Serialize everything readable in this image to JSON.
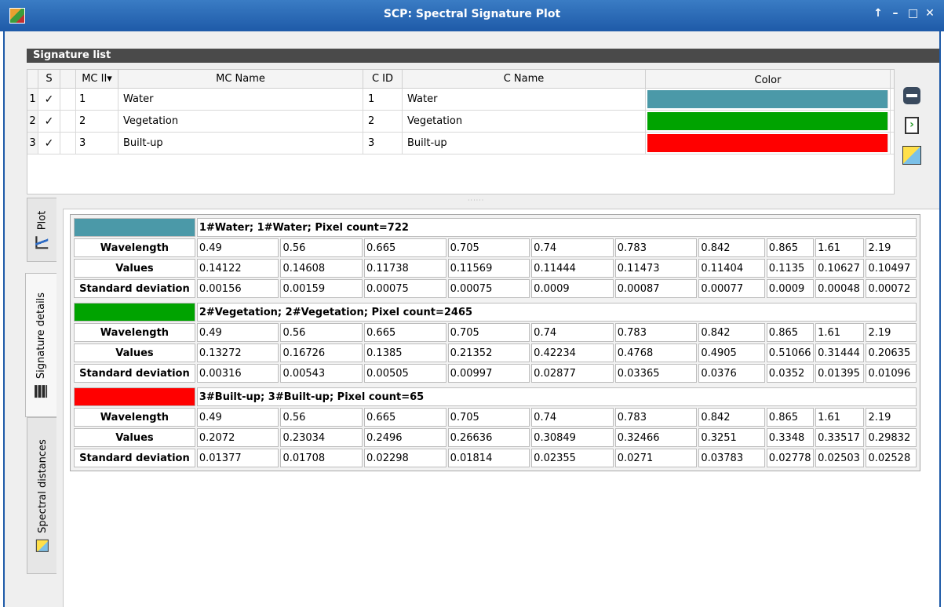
{
  "window": {
    "title": "SCP: Spectral Signature Plot",
    "controls": [
      "↑",
      "–",
      "□",
      "✕"
    ]
  },
  "section": {
    "title": "Signature list"
  },
  "siglist": {
    "headers": {
      "num": "",
      "s": "S",
      "mcid": "MC II",
      "mcid_arrow": "▾",
      "mcname": "MC Name",
      "cid": "C ID",
      "cname": "C Name",
      "color": "Color"
    },
    "rows": [
      {
        "num": "1",
        "check": "✓",
        "mcid": "1",
        "mcname": "Water",
        "cid": "1",
        "cname": "Water",
        "color": "#4b99a8"
      },
      {
        "num": "2",
        "check": "✓",
        "mcid": "2",
        "mcname": "Vegetation",
        "cid": "2",
        "cname": "Vegetation",
        "color": "#00a300"
      },
      {
        "num": "3",
        "check": "✓",
        "mcid": "3",
        "mcname": "Built-up",
        "cid": "3",
        "cname": "Built-up",
        "color": "#ff0000"
      }
    ]
  },
  "tabs": {
    "plot": "Plot",
    "details": "Signature details",
    "distances": "Spectral distances"
  },
  "details": {
    "labels": {
      "wavelength": "Wavelength",
      "values": "Values",
      "std": "Standard deviation"
    },
    "signatures": [
      {
        "color": "#4b99a8",
        "title": "1#Water; 1#Water; Pixel count=722",
        "wavelength": [
          "0.49",
          "0.56",
          "0.665",
          "0.705",
          "0.74",
          "0.783",
          "0.842",
          "0.865",
          "1.61",
          "2.19"
        ],
        "values": [
          "0.14122",
          "0.14608",
          "0.11738",
          "0.11569",
          "0.11444",
          "0.11473",
          "0.11404",
          "0.1135",
          "0.10627",
          "0.10497"
        ],
        "std": [
          "0.00156",
          "0.00159",
          "0.00075",
          "0.00075",
          "0.0009",
          "0.00087",
          "0.00077",
          "0.0009",
          "0.00048",
          "0.00072"
        ]
      },
      {
        "color": "#00a300",
        "title": "2#Vegetation; 2#Vegetation; Pixel count=2465",
        "wavelength": [
          "0.49",
          "0.56",
          "0.665",
          "0.705",
          "0.74",
          "0.783",
          "0.842",
          "0.865",
          "1.61",
          "2.19"
        ],
        "values": [
          "0.13272",
          "0.16726",
          "0.1385",
          "0.21352",
          "0.42234",
          "0.4768",
          "0.4905",
          "0.51066",
          "0.31444",
          "0.20635"
        ],
        "std": [
          "0.00316",
          "0.00543",
          "0.00505",
          "0.00997",
          "0.02877",
          "0.03365",
          "0.0376",
          "0.0352",
          "0.01395",
          "0.01096"
        ]
      },
      {
        "color": "#ff0000",
        "title": "3#Built-up; 3#Built-up; Pixel count=65",
        "wavelength": [
          "0.49",
          "0.56",
          "0.665",
          "0.705",
          "0.74",
          "0.783",
          "0.842",
          "0.865",
          "1.61",
          "2.19"
        ],
        "values": [
          "0.2072",
          "0.23034",
          "0.2496",
          "0.26636",
          "0.30849",
          "0.32466",
          "0.3251",
          "0.3348",
          "0.33517",
          "0.29832"
        ],
        "std": [
          "0.01377",
          "0.01708",
          "0.02298",
          "0.01814",
          "0.02355",
          "0.0271",
          "0.03783",
          "0.02778",
          "0.02503",
          "0.02528"
        ]
      }
    ]
  }
}
